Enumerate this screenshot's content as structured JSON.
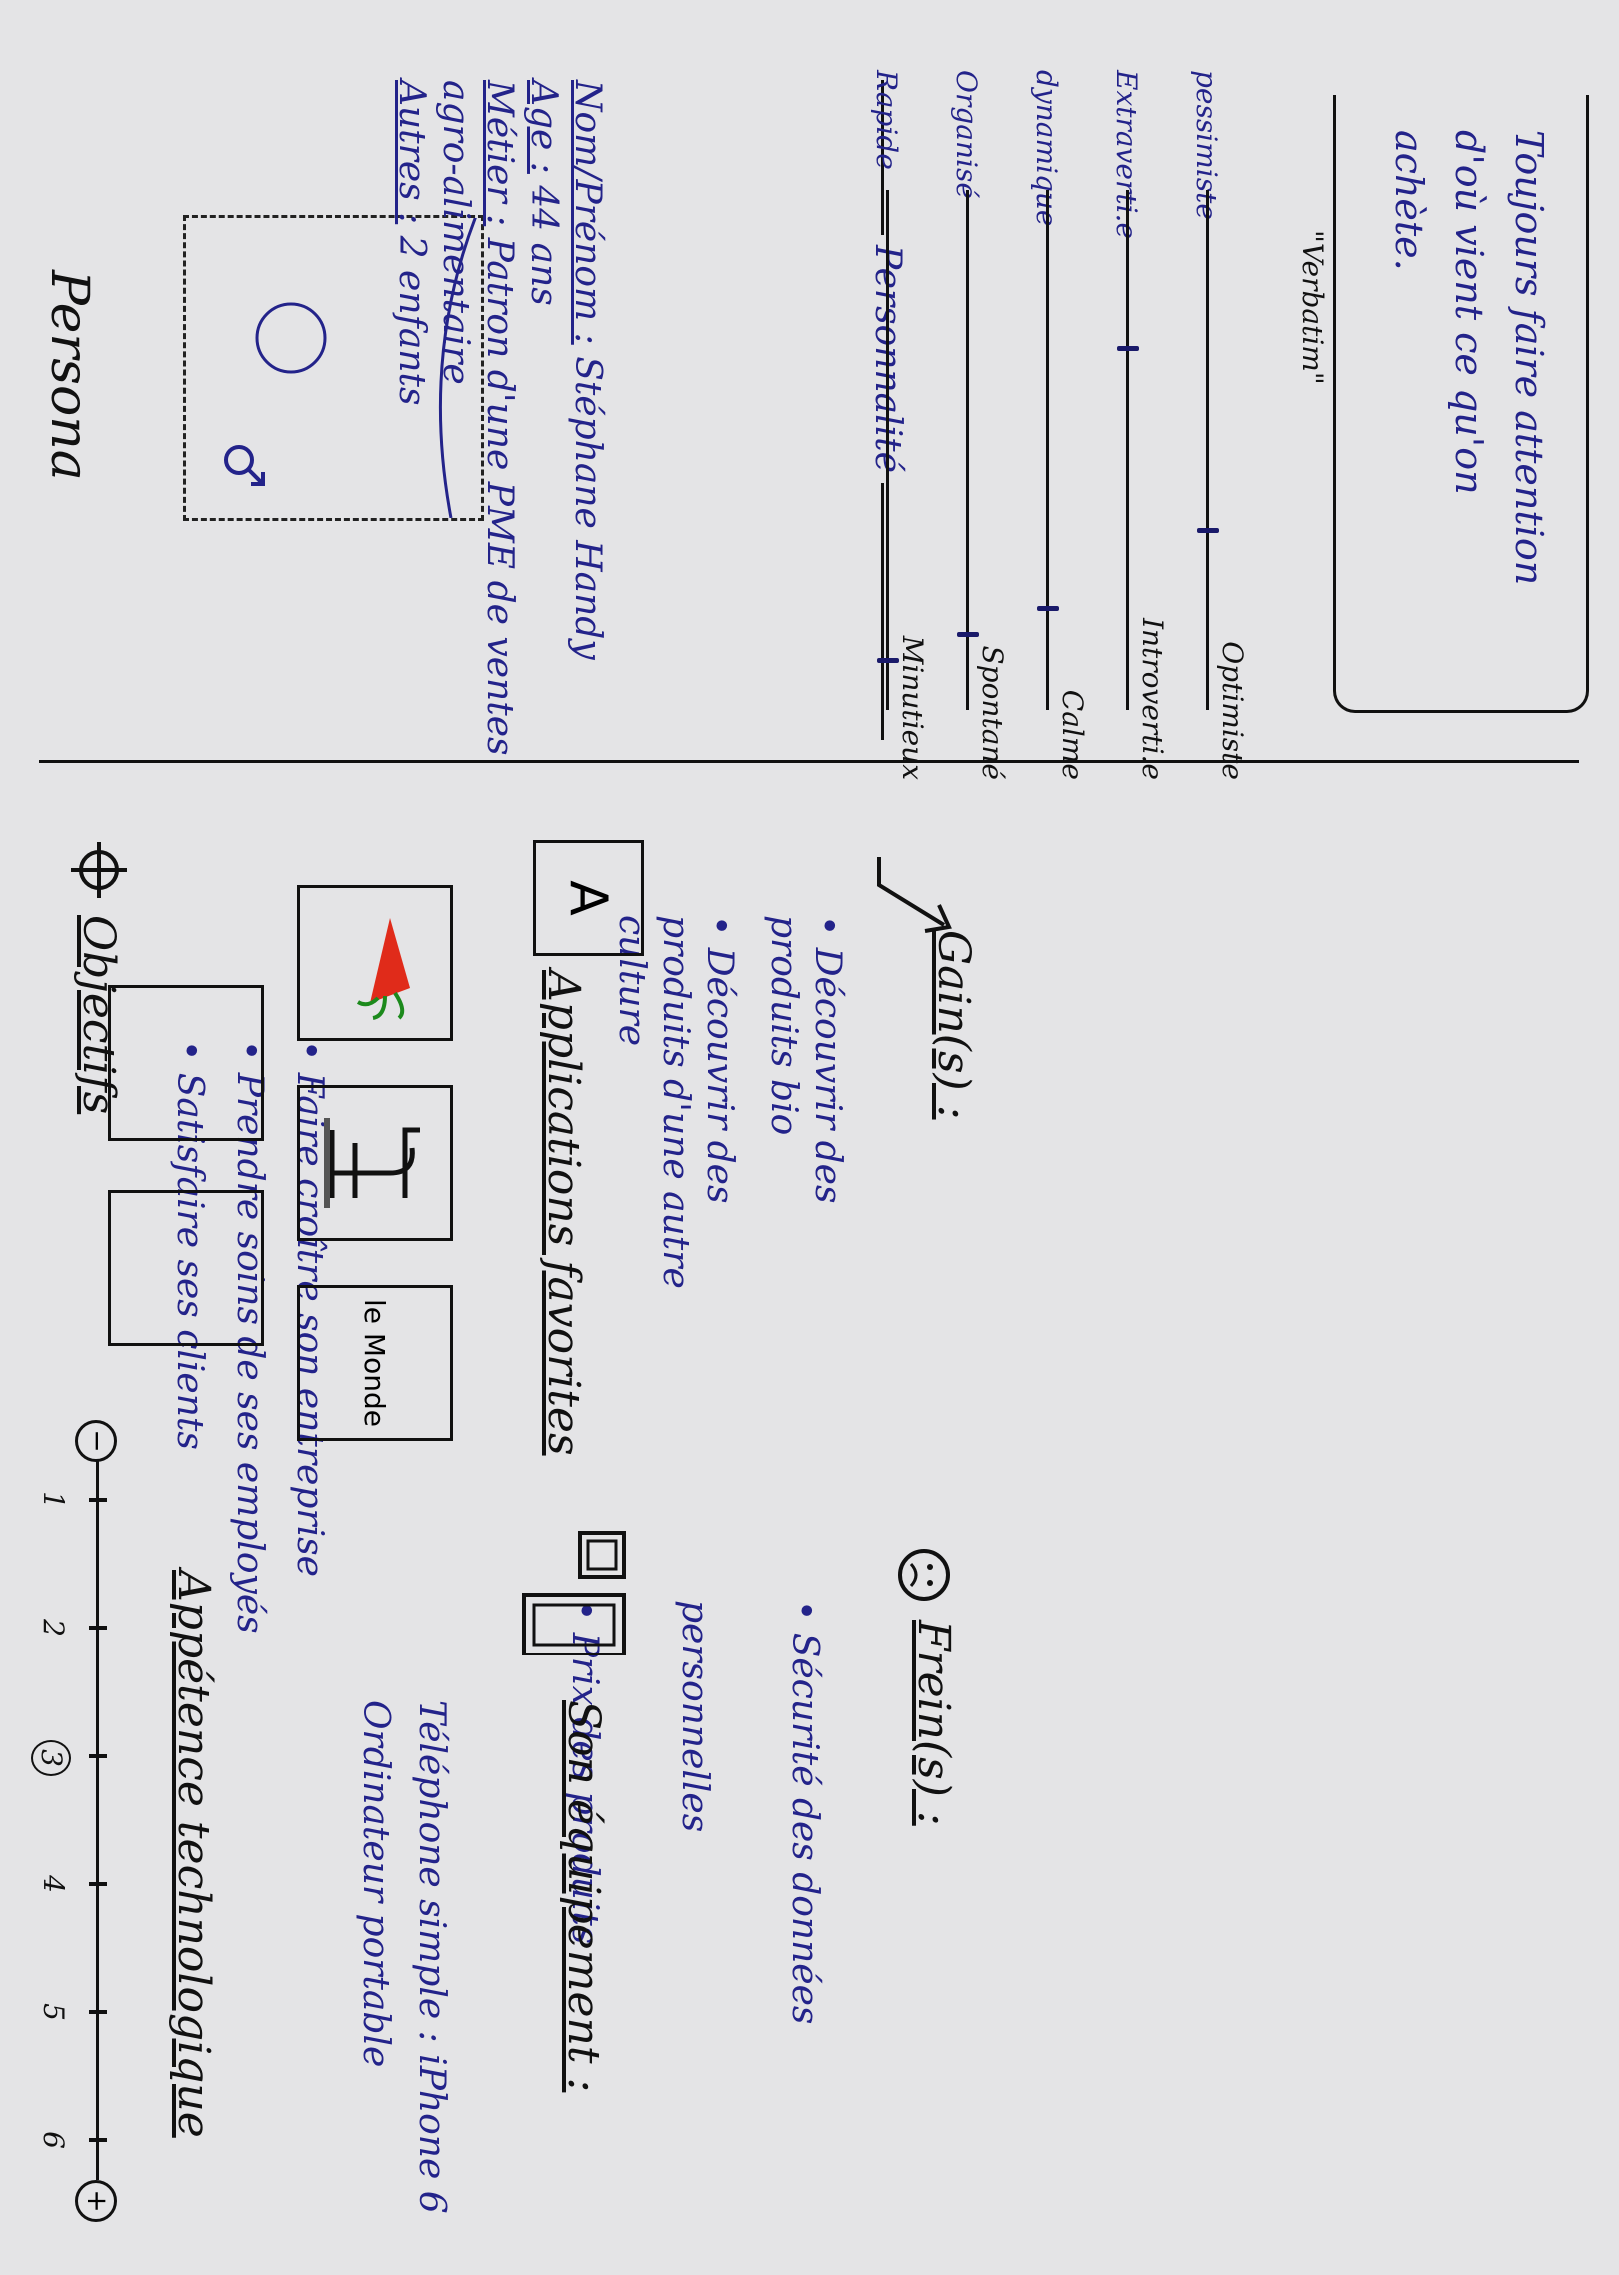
{
  "header": {
    "title": "Persona"
  },
  "identity": {
    "name_label": "Nom/Prénom :",
    "name_value": "Stéphane Handy",
    "age_label": "Age :",
    "age_value": "44 ans",
    "job_label": "Métier :",
    "job_value": "Patron d'une PME de ventes agro-alimentaire",
    "other_label": "Autres :",
    "other_value": "2 enfants"
  },
  "personality": {
    "title": "Personnalité",
    "sliders": [
      {
        "left": "Optimiste",
        "right": "pessimiste",
        "value": 0.35
      },
      {
        "left": "Introverti.e",
        "right": "Extraverti.e",
        "value": 0.7
      },
      {
        "left": "Calme",
        "right": "dynamique",
        "value": 0.2
      },
      {
        "left": "Spontané",
        "right": "Organisé",
        "value": 0.15
      },
      {
        "left": "Minutieux",
        "right": "Rapide",
        "value": 0.1
      }
    ]
  },
  "verbatim": {
    "title": "\"Verbatim\"",
    "text": [
      "Toujours faire attention",
      "d'où vient ce qu'on",
      "achète."
    ]
  },
  "objectives": {
    "title": "Objectifs",
    "items": [
      "Faire croître son entreprise",
      "Prendre soins de ses employés",
      "Satisfaire ses clients"
    ]
  },
  "gains": {
    "title": "Gain(s) :",
    "items": [
      "Découvrir des produits bio",
      "Découvrir des produits d'une autre culture"
    ]
  },
  "freins": {
    "title": "Frein(s) :",
    "items": [
      "Sécurité des données personnelles",
      "Prix des produits"
    ]
  },
  "apps": {
    "title": "Applications favorites",
    "letter_app": "A",
    "lemonde_app": "le Monde"
  },
  "equipment": {
    "title": "Son équipement :",
    "items": [
      "Téléphone simple : iPhone 6",
      "Ordinateur portable"
    ]
  },
  "tech": {
    "title": "Appétence technologique",
    "minus": "−",
    "plus": "+",
    "scale": [
      "1",
      "2",
      "3",
      "4",
      "5",
      "6"
    ],
    "selected": "3"
  },
  "icons": {
    "gender": "male-symbol-icon",
    "target": "target-icon",
    "gain": "arrow-up-icon",
    "frein": "sad-face-icon",
    "equipment": "computer-icon",
    "carrot": "carrot-icon",
    "facebook": "facebook-icon"
  }
}
